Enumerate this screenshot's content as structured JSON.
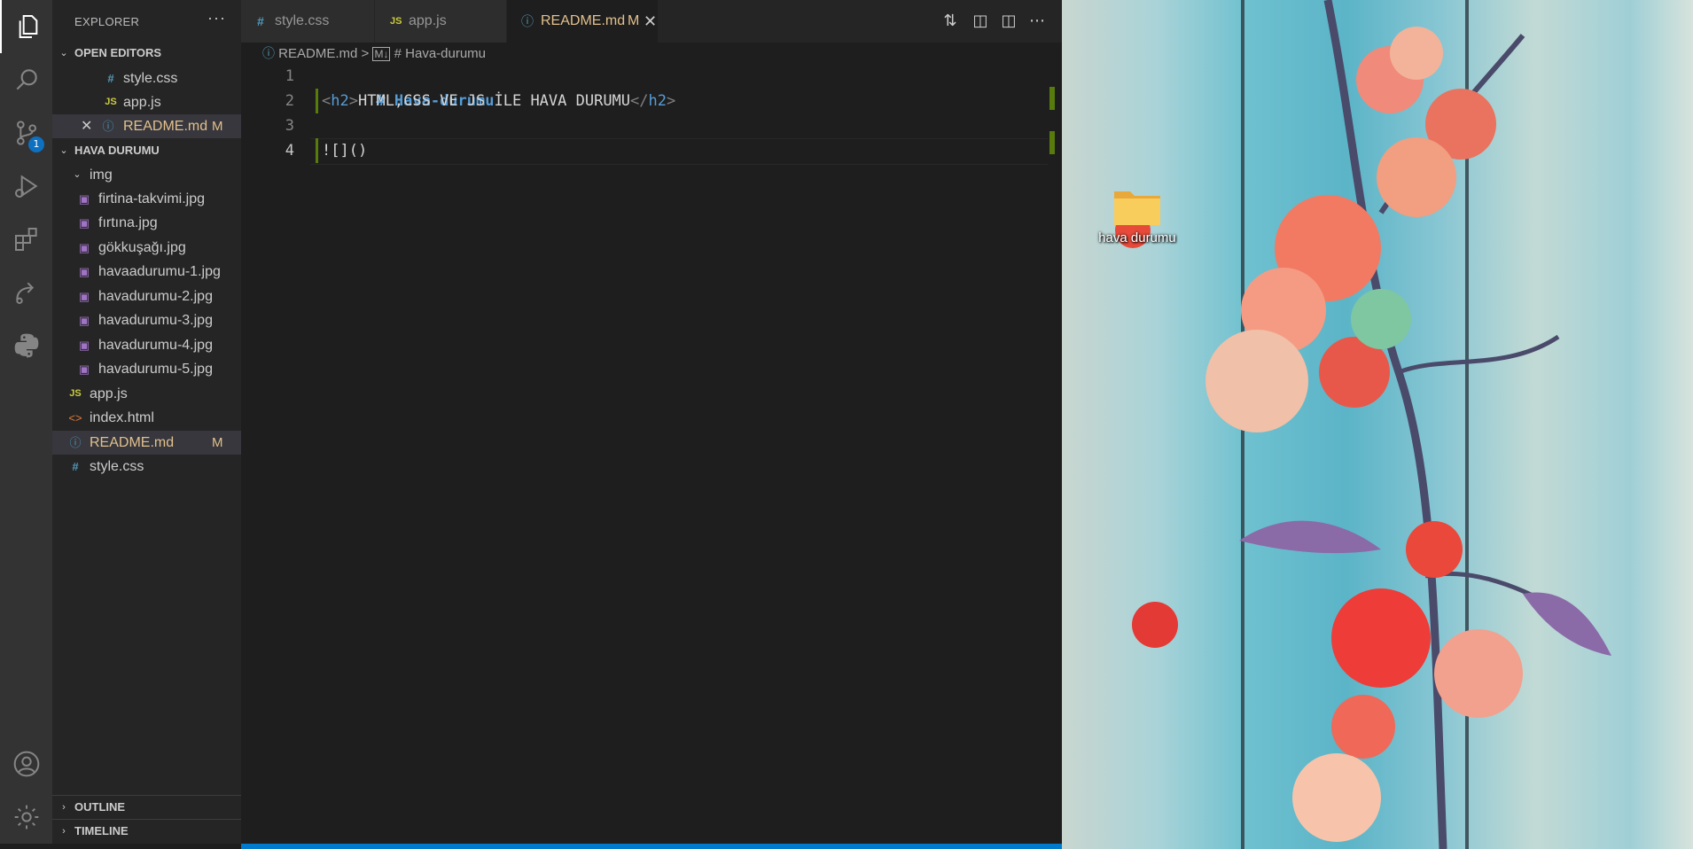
{
  "activity_bar": {
    "items": [
      "explorer-icon",
      "search-icon",
      "source-control-icon",
      "run-debug-icon",
      "extensions-icon",
      "remote-icon",
      "python-icon"
    ],
    "source_control_badge": "1",
    "bottom": [
      "account-icon",
      "manage-gear-icon"
    ]
  },
  "sidebar": {
    "title": "EXPLORER",
    "more": "···",
    "open_editors": {
      "label": "OPEN EDITORS",
      "items": [
        {
          "icon": "#",
          "name": "style.css"
        },
        {
          "icon": "JS",
          "name": "app.js"
        },
        {
          "icon": "ⓘ",
          "name": "README.md",
          "status": "M",
          "close": "✕"
        }
      ]
    },
    "folder": {
      "label": "HAVA DURUMU",
      "img_folder": "img",
      "img_files": [
        "firtina-takvimi.jpg",
        "fırtına.jpg",
        "gökkuşağı.jpg",
        "havaadurumu-1.jpg",
        "havadurumu-2.jpg",
        "havadurumu-3.jpg",
        "havadurumu-4.jpg",
        "havadurumu-5.jpg"
      ],
      "root_files": [
        {
          "icon": "JS",
          "name": "app.js"
        },
        {
          "icon": "<>",
          "name": "index.html"
        },
        {
          "icon": "ⓘ",
          "name": "README.md",
          "status": "M"
        },
        {
          "icon": "#",
          "name": "style.css"
        }
      ]
    },
    "outline_label": "OUTLINE",
    "timeline_label": "TIMELINE"
  },
  "editor": {
    "tabs": [
      {
        "icon": "#",
        "name": "style.css"
      },
      {
        "icon": "JS",
        "name": "app.js"
      },
      {
        "icon": "ⓘ",
        "name": "README.md",
        "status": "M",
        "close": "✕"
      }
    ],
    "breadcrumb": {
      "file": "README.md",
      "sep": ">",
      "symbol": "# Hava-durumu"
    },
    "lines": [
      {
        "n": "1",
        "heading": "# Hava-durumu"
      },
      {
        "n": "2",
        "open_br": "<",
        "open_tag": "h2",
        "open_br2": ">",
        "text": "HTML,CSS VE JS İLE HAVA DURUMU",
        "close_br": "</",
        "close_tag": "h2",
        "close_br2": ">"
      },
      {
        "n": "3",
        "text": ""
      },
      {
        "n": "4",
        "text": "![]()"
      }
    ]
  },
  "desktop": {
    "folder_label": "hava durumu"
  },
  "colors": {
    "activity_bg": "#333333",
    "sidebar_bg": "#252526",
    "editor_bg": "#1e1e1e",
    "accent": "#007acc",
    "modified": "#e2c08d"
  }
}
